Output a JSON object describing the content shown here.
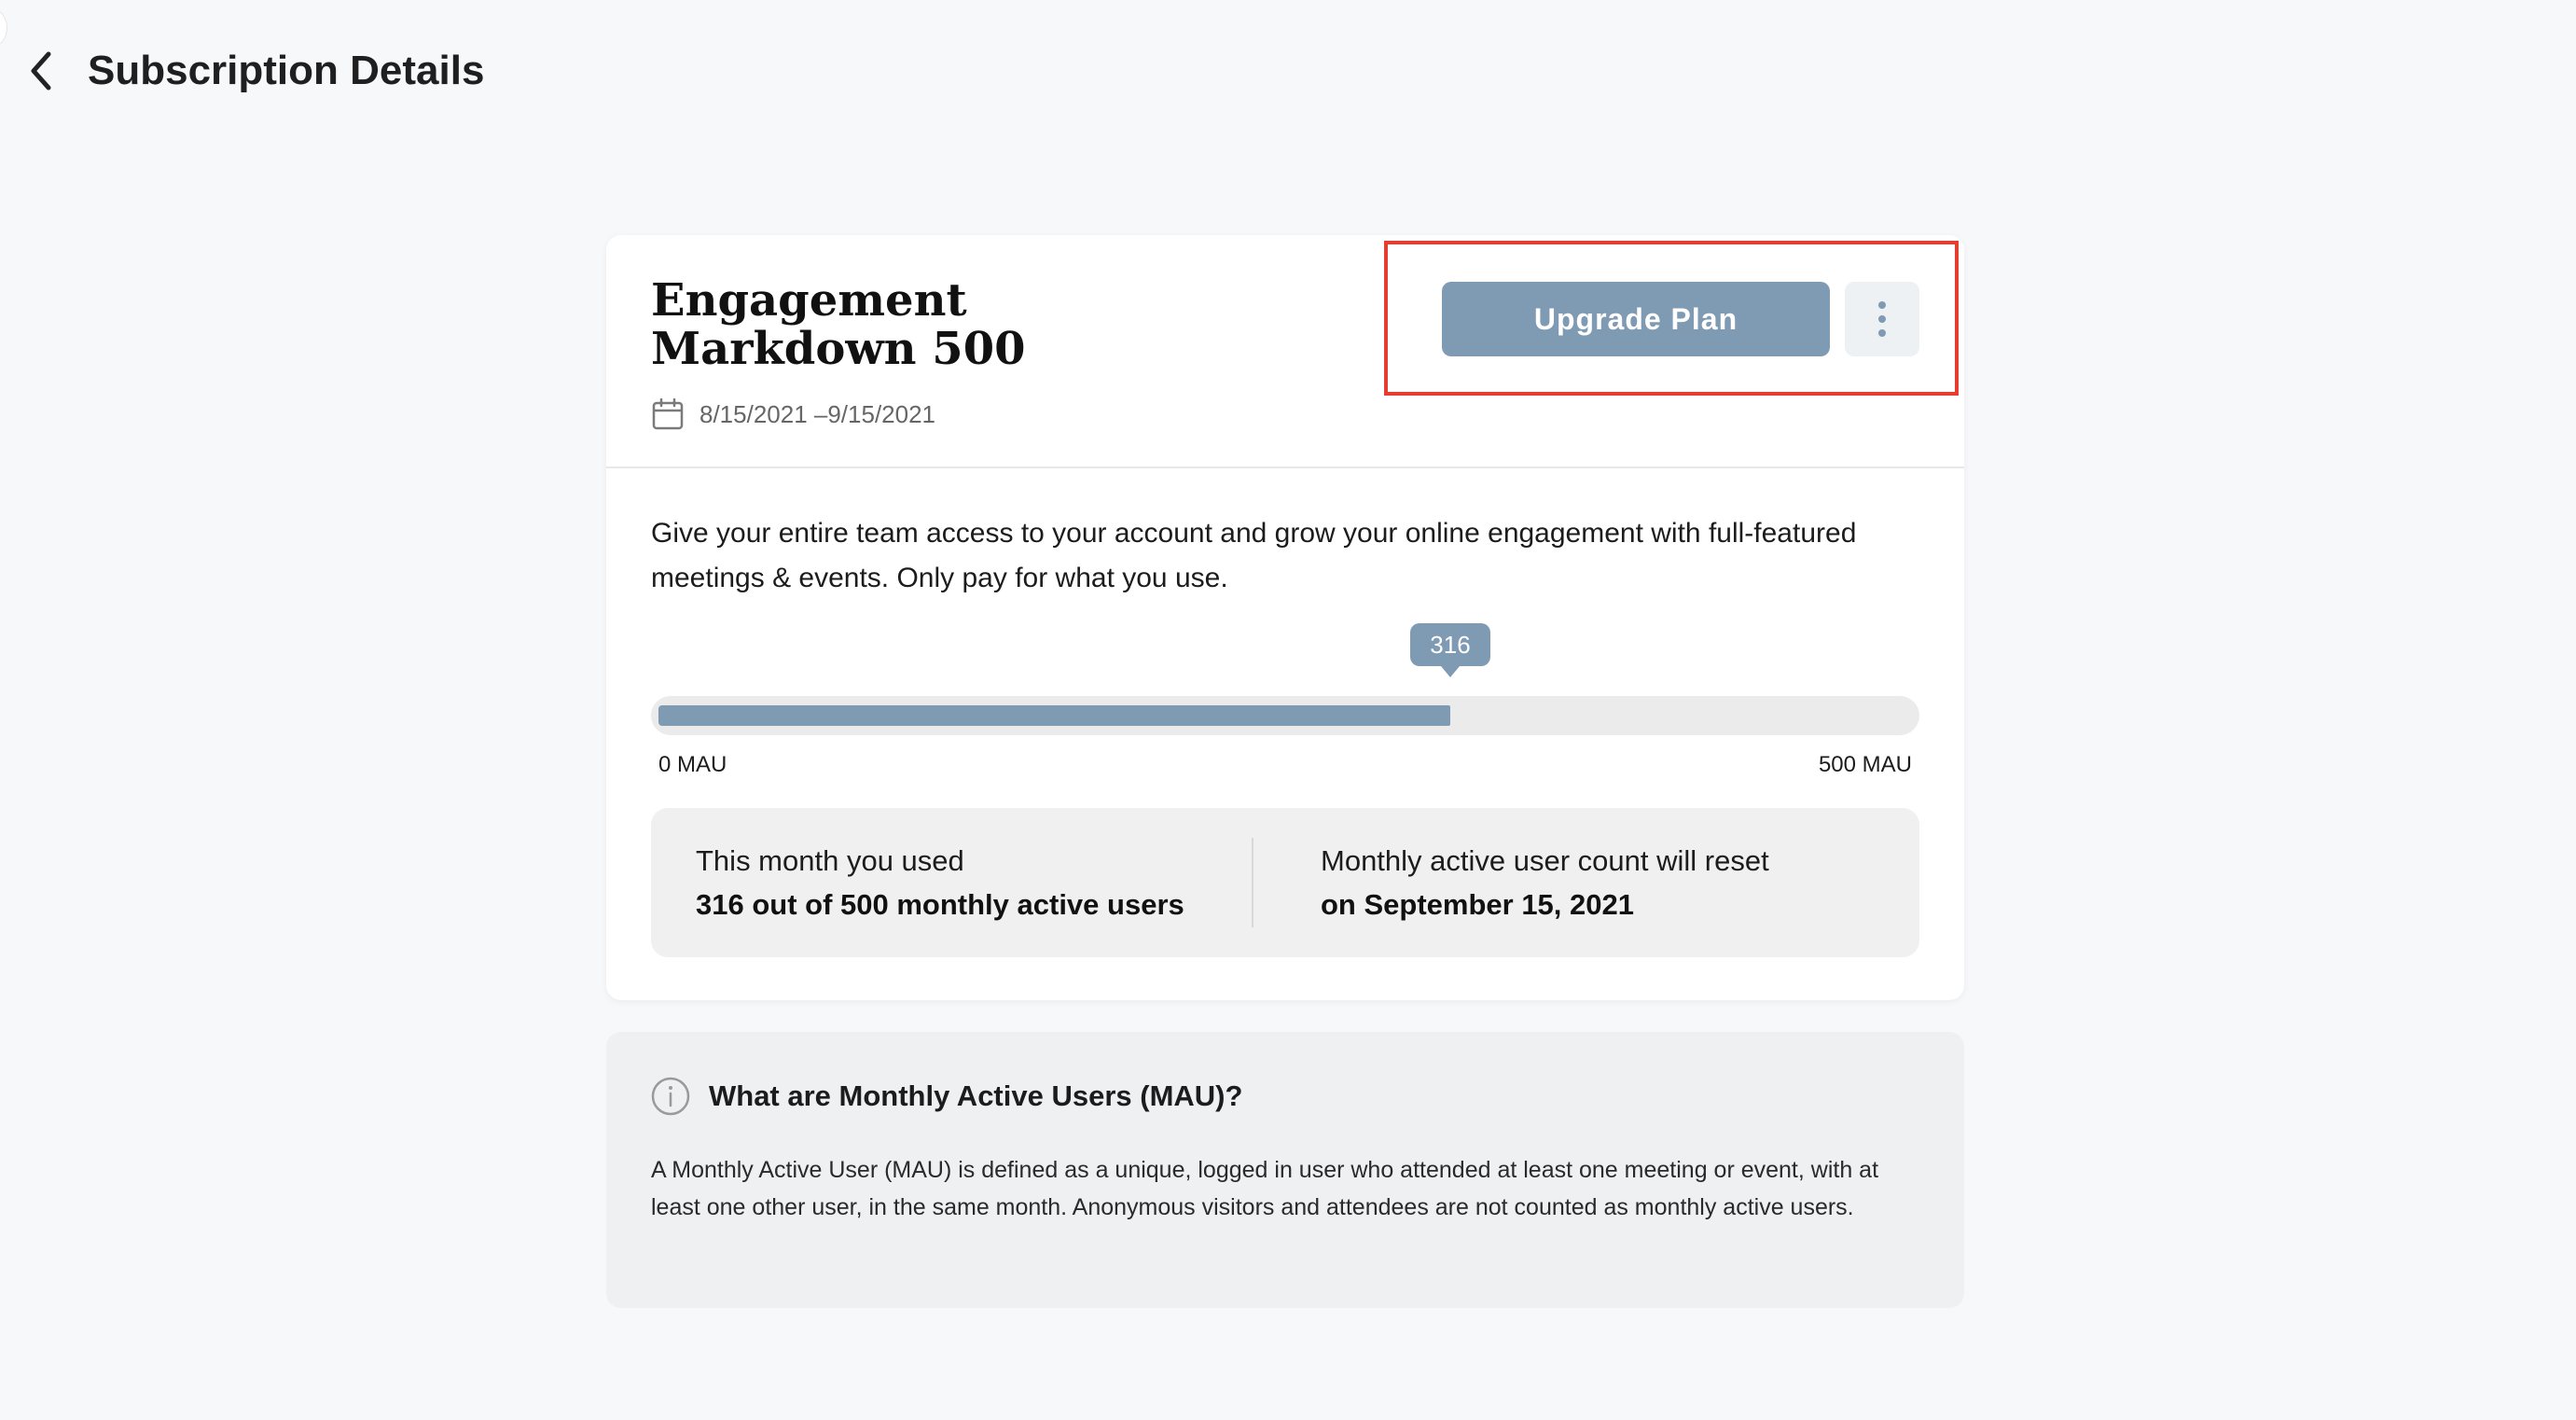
{
  "header": {
    "title": "Subscription Details",
    "back_icon": "chevron-left-icon"
  },
  "plan": {
    "name": "Engagement Markdown 500",
    "dates": "8/15/2021 –9/15/2021",
    "calendar_icon": "calendar-icon",
    "upgrade_label": "Upgrade Plan",
    "more_icon": "more-vertical-icon",
    "description": "Give your entire team access to your account and grow your online engagement with full-featured meetings & events. Only pay for what you use."
  },
  "usage": {
    "used": 316,
    "limit": 500,
    "tooltip": "316",
    "min_label": "0 MAU",
    "max_label": "500 MAU",
    "used_heading": "This month you used",
    "used_value": "316 out of 500 monthly active users",
    "reset_heading": "Monthly active user count will reset",
    "reset_value": "on September 15, 2021"
  },
  "info": {
    "icon": "info-icon",
    "title": "What are Monthly Active Users (MAU)?",
    "text": "A Monthly Active User (MAU) is defined as a unique, logged in user who attended at least one meeting or event, with at least one other user, in the same month. Anonymous visitors and attendees are not counted as monthly active users."
  },
  "colors": {
    "accent": "#7f9ab3",
    "highlight": "#e53d2f",
    "background": "#f7f8fa"
  }
}
